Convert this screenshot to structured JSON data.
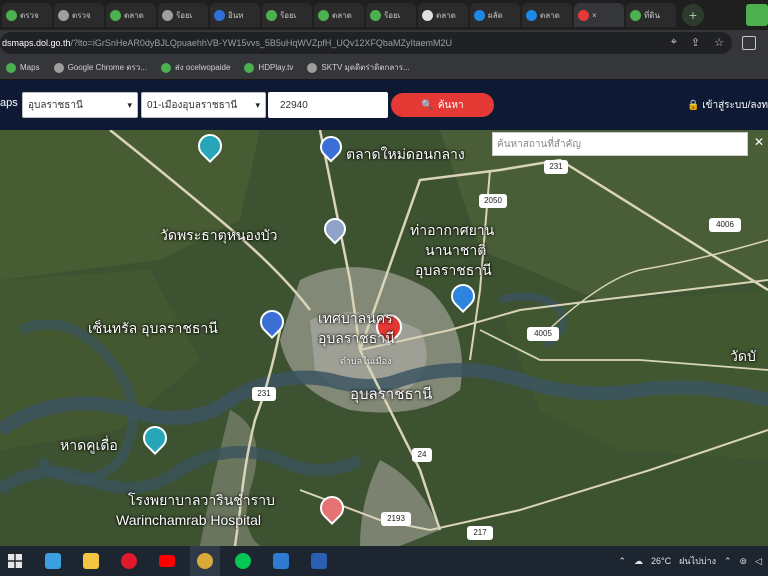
{
  "tabs": [
    {
      "label": "ตรวจ",
      "color": "#4caf50"
    },
    {
      "label": "ตรวจ",
      "color": "#9e9e9e"
    },
    {
      "label": "ตลาด",
      "color": "#4caf50"
    },
    {
      "label": "ร้อยเ",
      "color": "#9e9e9e"
    },
    {
      "label": "อินท",
      "color": "#2f6fd6"
    },
    {
      "label": "ร้อยเ",
      "color": "#4caf50"
    },
    {
      "label": "ตลาด",
      "color": "#4caf50"
    },
    {
      "label": "ร้อยเ",
      "color": "#4caf50"
    },
    {
      "label": "ตลาด",
      "color": "#e0e0e0"
    },
    {
      "label": "ผลัด",
      "color": "#1e88e5"
    },
    {
      "label": "ตลาด",
      "color": "#1e88e5"
    },
    {
      "label": "×",
      "color": "#e53935"
    },
    {
      "label": "ที่ดิน",
      "color": "#4caf50"
    }
  ],
  "new_tab": "+",
  "address": {
    "host": "dsmaps.dol.go.th",
    "rest": "/?lto=iGrSnHeAR0dyBJLQpuaehhVB-YW15vvs_5B5uHqWVZpfH_UQv12XFQbaMZyItaemM2U"
  },
  "bookmarks": [
    {
      "label": "Maps",
      "color": "#4caf50"
    },
    {
      "label": "Google Chrome ตรว...",
      "color": "#9e9e9e"
    },
    {
      "label": "ส่ง ocelwopaide",
      "color": "#4caf50"
    },
    {
      "label": "HDPlay.tv",
      "color": "#4caf50"
    },
    {
      "label": "SKTV มุดดิตร่าดิตกลาร...",
      "color": "#9e9e9e"
    }
  ],
  "map_header": {
    "brand": "aps",
    "province": "อุบลราชธานี",
    "district": "01-เมืองอุบลราชธานี",
    "postcode": "22940",
    "search_label": "ค้นหา",
    "login_label": "เข้าสู่ระบบ/ลงท"
  },
  "poi_search_placeholder": "ค้นหาสถานที่สำคัญ",
  "map_labels": {
    "market": "ตลาดใหม่ดอนกลาง",
    "temple": "วัดพระธาตุหนองบัว",
    "airport1": "ท่าอากาศยาน",
    "airport2": "นานาชาติ",
    "airport3": "อุบลราชธานี",
    "municipality": "เทศบาลนคร",
    "municipality2": "อุบลราชธานี",
    "mall": "เซ็นทรัล อุบลราชธานี",
    "subdistrict": "ตำบลในเมือง",
    "city": "อุบลราชธานี",
    "beach": "หาดคูเดื่อ",
    "hospital": "โรงพยาบาลวารินชำราบ",
    "hospital_en": "Warinchamrab Hospital",
    "wat_right": "วัดบั",
    "road_231a": "231",
    "road_2050": "2050",
    "road_4006": "4006",
    "road_4005": "4005",
    "road_231b": "231",
    "road_24": "24",
    "road_2193": "2193",
    "road_217": "217"
  },
  "taskbar": {
    "temperature": "26°C",
    "weather": "ฝนไปบ่าง",
    "icons": [
      "start",
      "widgets",
      "file-explorer",
      "opera",
      "youtube",
      "chrome",
      "line",
      "photos",
      "word"
    ]
  }
}
